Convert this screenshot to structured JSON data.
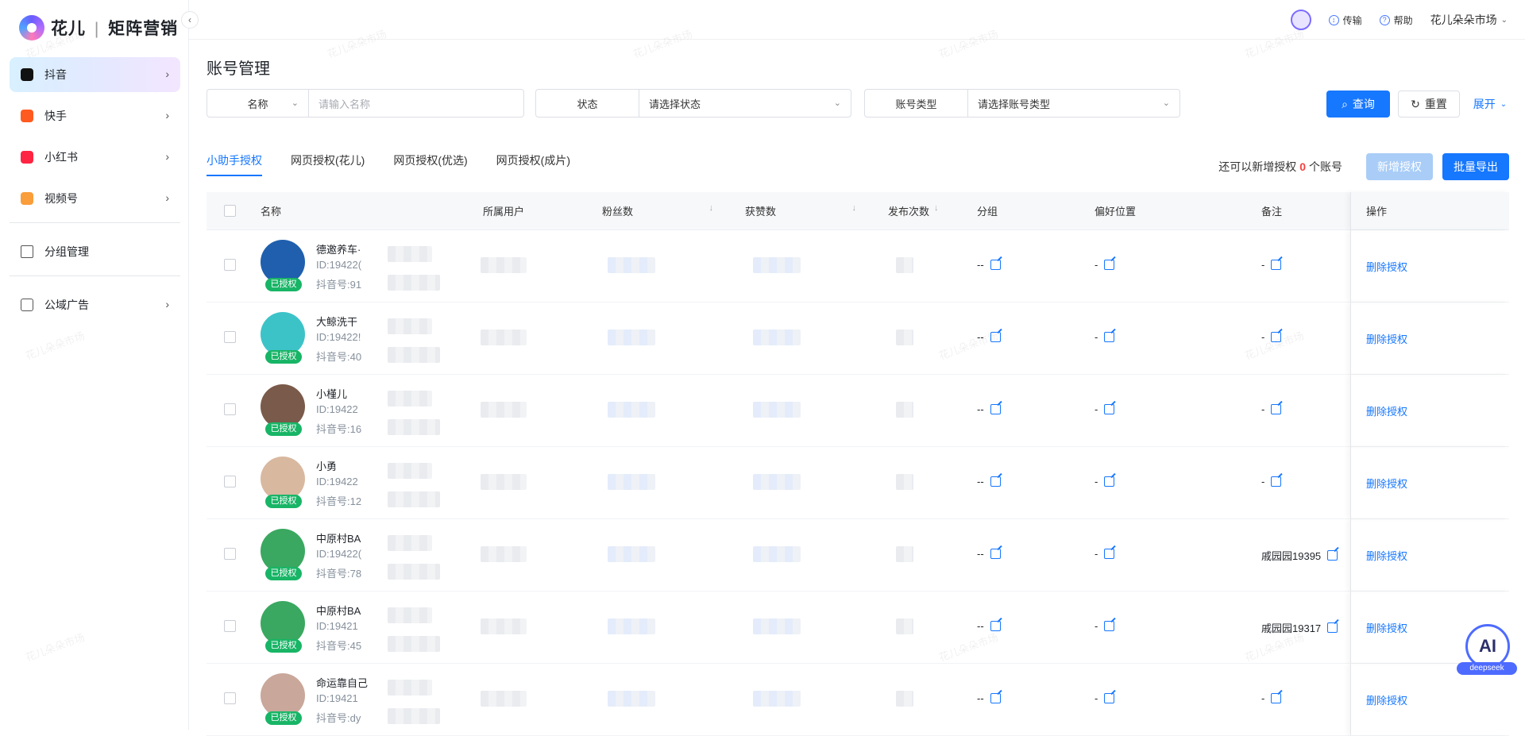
{
  "brand": {
    "name": "花儿",
    "product": "矩阵营销"
  },
  "sidebar": {
    "items": [
      {
        "label": "抖音",
        "icon": "douyin-icon",
        "color": "#111111",
        "active": true
      },
      {
        "label": "快手",
        "icon": "kuaishou-icon",
        "color": "#ff5a1f"
      },
      {
        "label": "小红书",
        "icon": "xiaohongshu-icon",
        "color": "#ff2442"
      },
      {
        "label": "视频号",
        "icon": "channels-icon",
        "color": "#fa9d3b"
      }
    ],
    "group_label": "分组管理",
    "ads_label": "公域广告"
  },
  "topbar": {
    "transfer": "传输",
    "help": "帮助",
    "store": "花儿朵朵市场"
  },
  "page": {
    "title": "账号管理"
  },
  "filters": {
    "name_label": "名称",
    "name_placeholder": "请输入名称",
    "status_label": "状态",
    "status_placeholder": "请选择状态",
    "type_label": "账号类型",
    "type_placeholder": "请选择账号类型",
    "query": "查询",
    "reset": "重置",
    "expand": "展开"
  },
  "tabs": [
    "小助手授权",
    "网页授权(花儿)",
    "网页授权(优选)",
    "网页授权(成片)"
  ],
  "quota": {
    "prefix": "还可以新增授权",
    "count": "0",
    "suffix": "个账号"
  },
  "actions": {
    "add": "新增授权",
    "export": "批量导出"
  },
  "table": {
    "columns": [
      "名称",
      "所属用户",
      "粉丝数",
      "获赞数",
      "发布次数",
      "分组",
      "偏好位置",
      "备注",
      "操作"
    ],
    "rows": [
      {
        "name": "德邀养车·",
        "id": "ID:19422(",
        "dy": "抖音号:91",
        "auth": "已授权",
        "group": "--",
        "pref": "-",
        "note": "-",
        "op": "删除授权",
        "avatar": "#1f5fae"
      },
      {
        "name": "大鲸洗干",
        "id": "ID:19422!",
        "dy": "抖音号:40",
        "auth": "已授权",
        "group": "--",
        "pref": "-",
        "note": "-",
        "op": "删除授权",
        "avatar": "#3cc3c8"
      },
      {
        "name": "小槿儿",
        "id": "ID:19422",
        "dy": "抖音号:16",
        "auth": "已授权",
        "group": "--",
        "pref": "-",
        "note": "-",
        "op": "删除授权",
        "avatar": "#7a5a4a"
      },
      {
        "name": "小勇",
        "id": "ID:19422",
        "dy": "抖音号:12",
        "auth": "已授权",
        "group": "--",
        "pref": "-",
        "note": "-",
        "op": "删除授权",
        "avatar": "#d9b8a0"
      },
      {
        "name": "中原村BA",
        "id": "ID:19422(",
        "dy": "抖音号:78",
        "auth": "已授权",
        "group": "--",
        "pref": "-",
        "note": "戚园园19395",
        "op": "删除授权",
        "avatar": "#3aa860"
      },
      {
        "name": "中原村BA",
        "id": "ID:19421",
        "dy": "抖音号:45",
        "auth": "已授权",
        "group": "--",
        "pref": "-",
        "note": "戚园园19317",
        "op": "删除授权",
        "avatar": "#3aa860"
      },
      {
        "name": "命运靠自己",
        "id": "ID:19421",
        "dy": "抖音号:dy",
        "auth": "已授权",
        "group": "--",
        "pref": "-",
        "note": "-",
        "op": "删除授权",
        "avatar": "#c9a79a"
      }
    ]
  },
  "fab": {
    "label": "AI",
    "tag": "deepseek"
  },
  "watermark": "花儿朵朵市场"
}
